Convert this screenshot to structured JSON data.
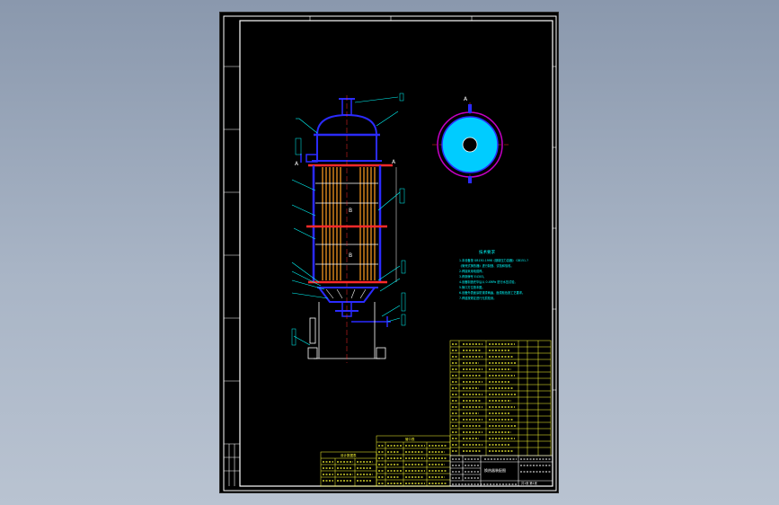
{
  "drawing": {
    "notes_title": "技术要求",
    "notes": [
      "1.本设备按 GB150-1998《钢制压力容器》 GB151-?",
      "《管壳式换热器》进行制造、试验和验收。",
      "2.焊接采用电弧焊。",
      "3.焊条牌号 E4303。",
      "4.设备制造完毕后以 0.XMPa 进行水压试验，",
      "5.管口方位按本图。",
      "6.设备外表面涂防锈漆两遍，面漆颜色按工艺要求。",
      "7.焊缝按规定进行无损检测。"
    ],
    "labels": {
      "section_top": "A",
      "section_a_left": "A",
      "section_a_right": "A",
      "tube_mid_1": "B",
      "tube_mid_2": "B"
    },
    "title_block": {
      "title": "换热器装配图",
      "sheet_id": "共1张 第1张"
    },
    "nozzle_table_title": "管口表",
    "tech_table_title": "设计数据表"
  },
  "colors": {
    "background": "#000000",
    "frame": "#ffffff",
    "shell": "#2b2bff",
    "tubes": "#e08a1e",
    "flange": "#ff2a2a",
    "section_fill": "#00ccff",
    "section_ring": "#c400c4",
    "table": "#ffff33",
    "leader": "#00ffff"
  }
}
